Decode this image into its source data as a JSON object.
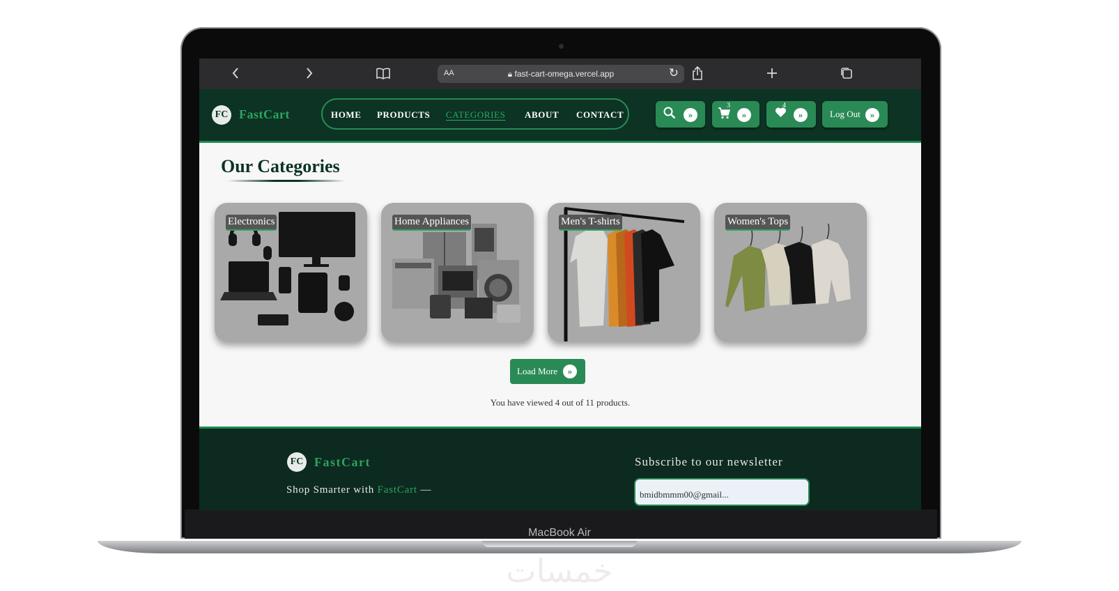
{
  "browser": {
    "back_icon": "chevron-left-icon",
    "forward_icon": "chevron-right-icon",
    "reader_mode_label": "AA",
    "url": "fast-cart-omega.vercel.app"
  },
  "header": {
    "logo_initials": "FC",
    "brand": "FastCart",
    "nav": [
      {
        "label": "HOME",
        "active": false
      },
      {
        "label": "PRODUCTS",
        "active": false
      },
      {
        "label": "CATEGORIES",
        "active": true
      },
      {
        "label": "ABOUT",
        "active": false
      },
      {
        "label": "CONTACT",
        "active": false
      }
    ],
    "cart_count": "3",
    "wishlist_count": "4",
    "logout_label": "Log Out"
  },
  "main": {
    "title": "Our Categories",
    "categories": [
      {
        "label": "Electronics"
      },
      {
        "label": "Home Appliances"
      },
      {
        "label": "Men's T-shirts"
      },
      {
        "label": "Women's Tops"
      }
    ],
    "load_more_label": "Load More",
    "viewed_text": "You have viewed 4 out of 11 products."
  },
  "footer": {
    "logo_initials": "FC",
    "brand": "FastCart",
    "tagline_prefix": "Shop Smarter with",
    "tagline_brand": "FastCart",
    "tagline_suffix": "—",
    "newsletter_title": "Subscribe to our newsletter",
    "email_value": "bmidbmmm00@gmail..."
  },
  "device": {
    "label": "MacBook Air",
    "watermark": "خمسات"
  },
  "colors": {
    "header_bg": "#0c3324",
    "accent_green": "#2a8a55",
    "footer_bg": "#0c2a20"
  }
}
